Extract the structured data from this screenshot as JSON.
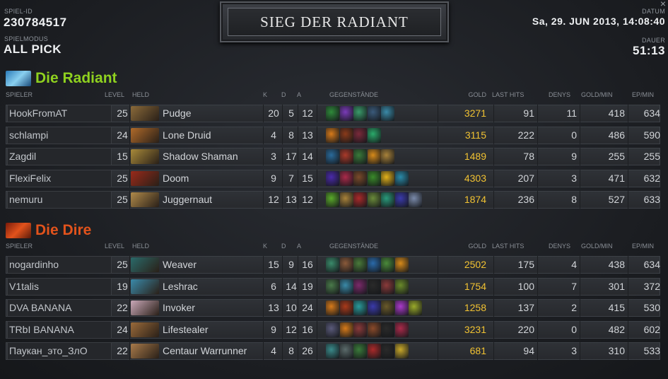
{
  "header": {
    "match_id_label": "SPIEL-ID",
    "match_id": "230784517",
    "mode_label": "SPIELMODUS",
    "mode": "ALL PICK",
    "title": "SIEG DER RADIANT",
    "date_label": "DATUM",
    "date": "Sa, 29. JUN 2013, 14:08:40",
    "duration_label": "DAUER",
    "duration": "51:13",
    "close_glyph": "×"
  },
  "columns": {
    "player": "SPIELER",
    "level": "LEVEL",
    "hero": "HELD",
    "k": "K",
    "d": "D",
    "a": "A",
    "items": "GEGENSTÄNDE",
    "gold": "GOLD",
    "last_hits": "LAST HITS",
    "denies": "DENYS",
    "gpm": "GOLD/MIN",
    "xpm": "EP/MIN"
  },
  "colors": {
    "radiant": "#8fd11f",
    "dire": "#e2531c",
    "gold": "#f1c232"
  },
  "radiant": {
    "name": "Die Radiant",
    "icon": "radiant-team-icon",
    "players": [
      {
        "player": "HookFromAT",
        "level": "25",
        "hero": "Pudge",
        "k": "20",
        "d": "5",
        "a": "12",
        "gold": "3271",
        "lh": "91",
        "dn": "11",
        "gpm": "418",
        "xpm": "634",
        "portrait": "#8a6a3a",
        "items": [
          "#2f8a3a",
          "#7a3bb8",
          "#3a9a6a",
          "#3a5a7a",
          "#3a8aa8"
        ]
      },
      {
        "player": "schlampi",
        "level": "24",
        "hero": "Lone Druid",
        "k": "4",
        "d": "8",
        "a": "13",
        "gold": "3115",
        "lh": "222",
        "dn": "0",
        "gpm": "486",
        "xpm": "590",
        "portrait": "#b06a2a",
        "items": [
          "#d67a1a",
          "#8a3a1a",
          "#7a2a3a",
          "#2aaa6a"
        ]
      },
      {
        "player": "Zagdil",
        "level": "15",
        "hero": "Shadow Shaman",
        "k": "3",
        "d": "17",
        "a": "14",
        "gold": "1489",
        "lh": "78",
        "dn": "9",
        "gpm": "255",
        "xpm": "255",
        "portrait": "#a88a3a",
        "items": [
          "#2a6a9a",
          "#aa3a2a",
          "#3a7a3a",
          "#d68a1a",
          "#a8823a"
        ]
      },
      {
        "player": "FlexiFelix",
        "level": "25",
        "hero": "Doom",
        "k": "9",
        "d": "7",
        "a": "15",
        "gold": "4303",
        "lh": "207",
        "dn": "3",
        "gpm": "471",
        "xpm": "632",
        "portrait": "#9a2a1a",
        "items": [
          "#4a2aaa",
          "#aa2a4a",
          "#7a4a2a",
          "#3a8a2a",
          "#e2b21a",
          "#2a8aa8"
        ]
      },
      {
        "player": "nemuru",
        "level": "25",
        "hero": "Juggernaut",
        "k": "12",
        "d": "13",
        "a": "12",
        "gold": "1874",
        "lh": "236",
        "dn": "8",
        "gpm": "527",
        "xpm": "633",
        "portrait": "#b08a4a",
        "items": [
          "#5aaa2a",
          "#a8823a",
          "#aa2a2a",
          "#6a8a3a",
          "#2a9a7a",
          "#3a3aaa",
          "#7a8aaa"
        ]
      }
    ]
  },
  "dire": {
    "name": "Die Dire",
    "icon": "dire-team-icon",
    "players": [
      {
        "player": "nogardinho",
        "level": "25",
        "hero": "Weaver",
        "k": "15",
        "d": "9",
        "a": "16",
        "gold": "2502",
        "lh": "175",
        "dn": "4",
        "gpm": "438",
        "xpm": "634",
        "portrait": "#2a6a6a",
        "items": [
          "#3a8a6a",
          "#8a5a3a",
          "#4a7a3a",
          "#2a6aaa",
          "#4a8a3a",
          "#d68a1a"
        ]
      },
      {
        "player": "V1talis",
        "level": "19",
        "hero": "Leshrac",
        "k": "6",
        "d": "14",
        "a": "19",
        "gold": "1754",
        "lh": "100",
        "dn": "7",
        "gpm": "301",
        "xpm": "372",
        "portrait": "#3a8aaa",
        "items": [
          "#4a7a4a",
          "#3a8aa8",
          "#7a2a6a",
          "#2a2a2a",
          "#8a3a3a",
          "#6a8a2a"
        ]
      },
      {
        "player": "DVA BANANA",
        "level": "22",
        "hero": "Invoker",
        "k": "13",
        "d": "10",
        "a": "24",
        "gold": "1258",
        "lh": "137",
        "dn": "2",
        "gpm": "415",
        "xpm": "530",
        "portrait": "#c9a8b8",
        "items": [
          "#d67a1a",
          "#aa3a1a",
          "#2a9a9a",
          "#3a3aaa",
          "#6a5a2a",
          "#aa3aca",
          "#9aaa2a"
        ]
      },
      {
        "player": "TRbI BANANA",
        "level": "24",
        "hero": "Lifestealer",
        "k": "9",
        "d": "12",
        "a": "16",
        "gold": "3231",
        "lh": "220",
        "dn": "0",
        "gpm": "482",
        "xpm": "602",
        "portrait": "#9a6a3a",
        "items": [
          "#5a5a7a",
          "#d67a1a",
          "#8a3a3a",
          "#8a4a2a",
          "#2a2a2a",
          "#aa2a4a"
        ]
      },
      {
        "player": "Паукан_это_ЗлО",
        "level": "22",
        "hero": "Centaur Warrunner",
        "k": "4",
        "d": "8",
        "a": "26",
        "gold": "681",
        "lh": "94",
        "dn": "3",
        "gpm": "310",
        "xpm": "533",
        "portrait": "#a87a4a",
        "items": [
          "#3a8a8a",
          "#5a6a6a",
          "#3a7a3a",
          "#aa2a2a",
          "#2a2a2a",
          "#c8a82a"
        ]
      }
    ]
  }
}
